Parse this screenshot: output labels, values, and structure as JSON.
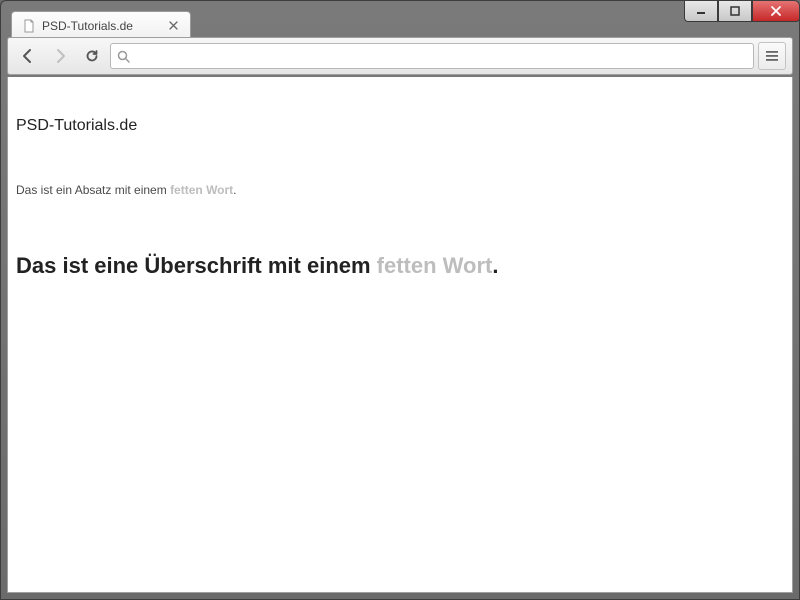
{
  "window": {
    "controls": {
      "minimize": "minimize",
      "maximize": "maximize",
      "close": "close"
    }
  },
  "browser": {
    "tab": {
      "title": "PSD-Tutorials.de",
      "favicon": "page-icon"
    },
    "omnibox": {
      "value": "",
      "placeholder": ""
    }
  },
  "page": {
    "site_title": "PSD-Tutorials.de",
    "paragraph": {
      "before": "Das ist ein Absatz mit einem ",
      "bold": "fetten Wort",
      "after": "."
    },
    "heading": {
      "before": "Das ist eine Überschrift mit einem ",
      "bold": "fetten Wort",
      "after": "."
    }
  }
}
